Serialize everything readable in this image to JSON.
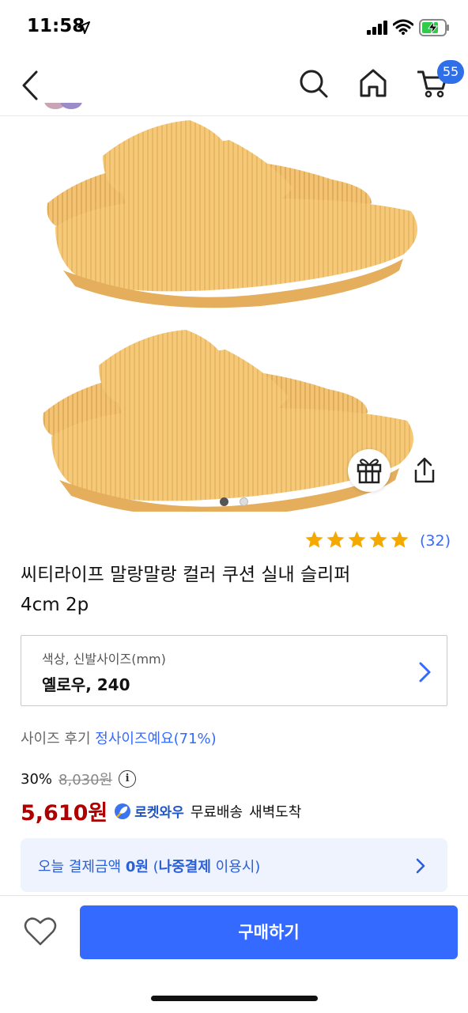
{
  "status_bar": {
    "time": "11:58",
    "battery": "charging"
  },
  "nav": {
    "back_icon": "chevron-left-icon",
    "search_icon": "search-icon",
    "home_icon": "home-icon",
    "cart_icon": "cart-icon",
    "cart_count": "55"
  },
  "gallery": {
    "image_count": 2,
    "active_index": 0
  },
  "rating": {
    "stars": 5,
    "count": "(32)"
  },
  "product": {
    "title_line1": "씨티라이프 말랑말랑 컬러 쿠션 실내 슬리퍼",
    "title_line2": "4cm 2p"
  },
  "option": {
    "label": "색상, 신발사이즈(mm)",
    "value": "옐로우, 240"
  },
  "size_review": {
    "label": "사이즈 후기",
    "value": "정사이즈예요(71%)"
  },
  "pricing": {
    "discount": "30%",
    "original_price": "8,030원",
    "sale_price": "5,610원",
    "rocket_label": "로켓와우",
    "shipping_free": "무료배송",
    "dawn_delivery": "새벽도착"
  },
  "pay_banner": {
    "prefix": "오늘 결제금액 ",
    "amount": "0원",
    "paren_open": " (",
    "later_pay": "나중결제",
    "suffix": " 이용시)"
  },
  "buy_button": "구매하기",
  "colors": {
    "accent": "#346aff",
    "price_red": "#ae0000",
    "star": "#f5a800",
    "slipper": "#f6c978"
  }
}
